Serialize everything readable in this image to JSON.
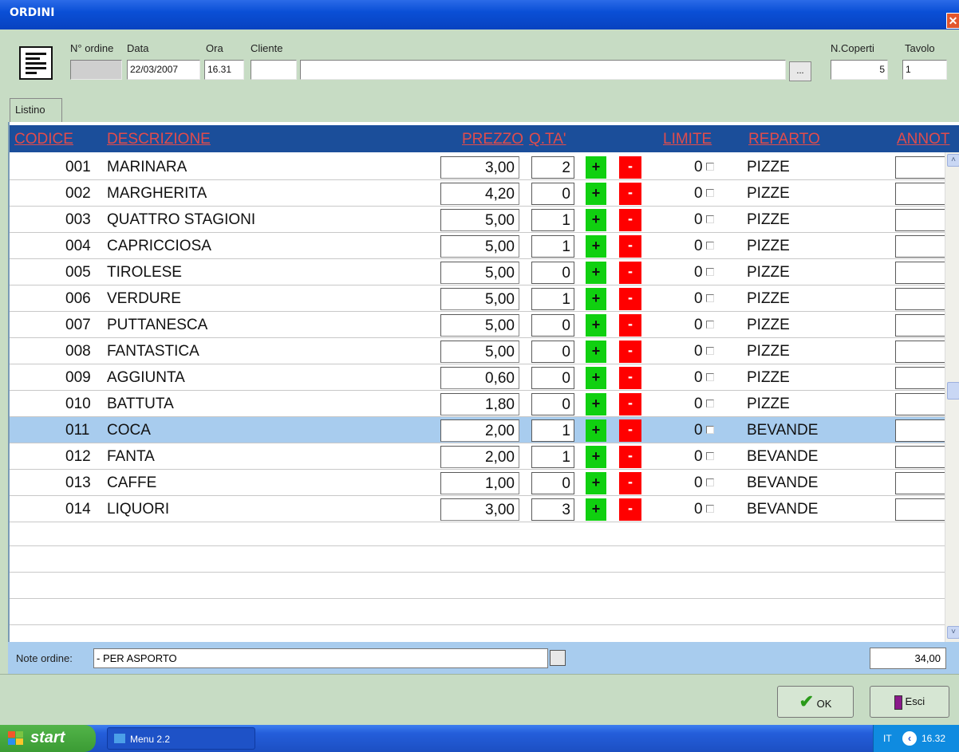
{
  "window": {
    "title": "ORDINI",
    "close": "✕"
  },
  "header": {
    "labels": {
      "n_ordine": "N° ordine",
      "data": "Data",
      "ora": "Ora",
      "cliente": "Cliente",
      "n_coperti": "N.Coperti",
      "tavolo": "Tavolo"
    },
    "values": {
      "n_ordine": "",
      "data": "22/03/2007",
      "ora": "16.31",
      "cliente_code": "",
      "cliente_name": "",
      "n_coperti": "5",
      "tavolo": "1"
    },
    "browse_button": "..."
  },
  "tabs": [
    {
      "label": "Listino"
    }
  ],
  "grid": {
    "columns": {
      "codice": "CODICE",
      "descrizione": "DESCRIZIONE",
      "prezzo": "PREZZO",
      "qta": "Q.TA'",
      "limite": "LIMITE",
      "reparto": "REPARTO",
      "annot": "ANNOT"
    },
    "rows": [
      {
        "code": "001",
        "desc": "MARINARA",
        "price": "3,00",
        "qty": "2",
        "limit": "0",
        "dept": "PIZZE",
        "selected": false
      },
      {
        "code": "002",
        "desc": "MARGHERITA",
        "price": "4,20",
        "qty": "0",
        "limit": "0",
        "dept": "PIZZE",
        "selected": false
      },
      {
        "code": "003",
        "desc": "QUATTRO STAGIONI",
        "price": "5,00",
        "qty": "1",
        "limit": "0",
        "dept": "PIZZE",
        "selected": false
      },
      {
        "code": "004",
        "desc": "CAPRICCIOSA",
        "price": "5,00",
        "qty": "1",
        "limit": "0",
        "dept": "PIZZE",
        "selected": false
      },
      {
        "code": "005",
        "desc": "TIROLESE",
        "price": "5,00",
        "qty": "0",
        "limit": "0",
        "dept": "PIZZE",
        "selected": false
      },
      {
        "code": "006",
        "desc": "VERDURE",
        "price": "5,00",
        "qty": "1",
        "limit": "0",
        "dept": "PIZZE",
        "selected": false
      },
      {
        "code": "007",
        "desc": "PUTTANESCA",
        "price": "5,00",
        "qty": "0",
        "limit": "0",
        "dept": "PIZZE",
        "selected": false
      },
      {
        "code": "008",
        "desc": "FANTASTICA",
        "price": "5,00",
        "qty": "0",
        "limit": "0",
        "dept": "PIZZE",
        "selected": false
      },
      {
        "code": "009",
        "desc": "AGGIUNTA",
        "price": "0,60",
        "qty": "0",
        "limit": "0",
        "dept": "PIZZE",
        "selected": false
      },
      {
        "code": "010",
        "desc": "BATTUTA",
        "price": "1,80",
        "qty": "0",
        "limit": "0",
        "dept": "PIZZE",
        "selected": false
      },
      {
        "code": "011",
        "desc": "COCA",
        "price": "2,00",
        "qty": "1",
        "limit": "0",
        "dept": "BEVANDE",
        "selected": true
      },
      {
        "code": "012",
        "desc": "FANTA",
        "price": "2,00",
        "qty": "1",
        "limit": "0",
        "dept": "BEVANDE",
        "selected": false
      },
      {
        "code": "013",
        "desc": "CAFFE",
        "price": "1,00",
        "qty": "0",
        "limit": "0",
        "dept": "BEVANDE",
        "selected": false
      },
      {
        "code": "014",
        "desc": "LIQUORI",
        "price": "3,00",
        "qty": "3",
        "limit": "0",
        "dept": "BEVANDE",
        "selected": false
      }
    ],
    "plus_label": "+",
    "minus_label": "-"
  },
  "notes": {
    "label": "Note ordine:",
    "value": "- PER ASPORTO",
    "total": "34,00"
  },
  "buttons": {
    "ok": "OK",
    "esci": "Esci"
  },
  "taskbar": {
    "start": "start",
    "task": "Menu 2.2",
    "lang": "IT",
    "clock": "16.32"
  },
  "colors": {
    "title": "#0a4fd6",
    "header_bg": "#1b4e9a",
    "header_text": "#e14c4c",
    "plus": "#10d010",
    "minus": "#ff0000",
    "selected": "#a8ccee",
    "panel": "#c7dcc4"
  }
}
